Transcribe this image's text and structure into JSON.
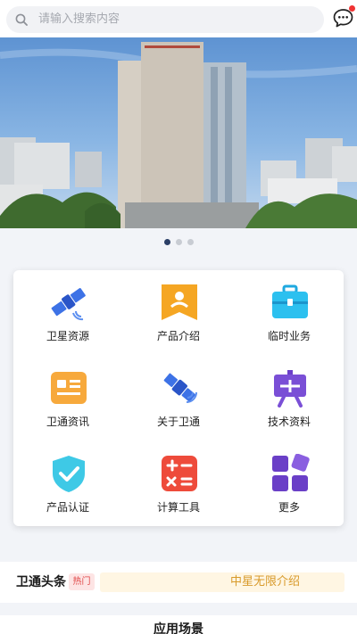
{
  "search": {
    "placeholder": "请输入搜索内容"
  },
  "carousel": {
    "page_count": 3,
    "active_index": 0
  },
  "menu": [
    {
      "label": "卫星资源",
      "icon": "satellite-icon"
    },
    {
      "label": "产品介绍",
      "icon": "bookmark-icon"
    },
    {
      "label": "临时业务",
      "icon": "briefcase-icon"
    },
    {
      "label": "卫通资讯",
      "icon": "news-card-icon"
    },
    {
      "label": "关于卫通",
      "icon": "satellite-info-icon"
    },
    {
      "label": "技术资料",
      "icon": "presentation-board-icon"
    },
    {
      "label": "产品认证",
      "icon": "shield-check-icon"
    },
    {
      "label": "计算工具",
      "icon": "calculator-icon"
    },
    {
      "label": "更多",
      "icon": "more-grid-icon"
    }
  ],
  "news": {
    "title": "卫通头条",
    "tag": "热门",
    "headline": "中星无限介绍"
  },
  "section": {
    "title": "应用场景"
  },
  "colors": {
    "accent_blue": "#3b6fe0",
    "hot_red": "#e04545",
    "headline_gold": "#d89a2b"
  }
}
